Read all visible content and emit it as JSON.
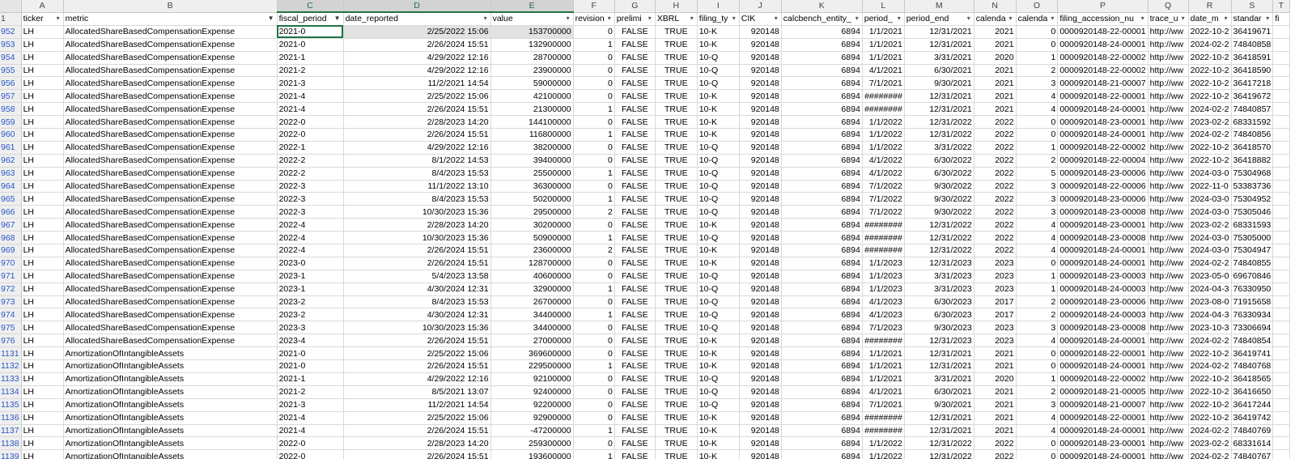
{
  "column_letters": [
    "A",
    "B",
    "C",
    "D",
    "E",
    "F",
    "G",
    "H",
    "I",
    "J",
    "K",
    "L",
    "M",
    "N",
    "O",
    "P",
    "Q",
    "R",
    "S",
    "T"
  ],
  "header_row_number": "1",
  "headers": [
    "ticker",
    "metric",
    "fiscal_period",
    "date_reported",
    "value",
    "revision",
    "prelimi",
    "XBRL",
    "filing_ty",
    "CIK",
    "calcbench_entity_",
    "period_",
    "period_end",
    "calenda",
    "calenda",
    "filing_accession_nu",
    "trace_u",
    "date_m",
    "standar",
    "fi"
  ],
  "filtered_columns": [
    "metric",
    "fiscal_period"
  ],
  "rows": [
    {
      "n": "952",
      "c": [
        "LH",
        "AllocatedShareBasedCompensationExpense",
        "2021-0",
        "2/25/2022 15:06",
        "153700000",
        "0",
        "FALSE",
        "TRUE",
        "10-K",
        "920148",
        "6894",
        "1/1/2021",
        "12/31/2021",
        "2021",
        "0",
        "0000920148-22-00001",
        "http://ww",
        "2022-10-2",
        "36419671",
        ""
      ]
    },
    {
      "n": "953",
      "c": [
        "LH",
        "AllocatedShareBasedCompensationExpense",
        "2021-0",
        "2/26/2024 15:51",
        "132900000",
        "1",
        "FALSE",
        "TRUE",
        "10-K",
        "920148",
        "6894",
        "1/1/2021",
        "12/31/2021",
        "2021",
        "0",
        "0000920148-24-00001",
        "http://ww",
        "2024-02-2",
        "74840858",
        ""
      ]
    },
    {
      "n": "954",
      "c": [
        "LH",
        "AllocatedShareBasedCompensationExpense",
        "2021-1",
        "4/29/2022 12:16",
        "28700000",
        "0",
        "FALSE",
        "TRUE",
        "10-Q",
        "920148",
        "6894",
        "1/1/2021",
        "3/31/2021",
        "2020",
        "1",
        "0000920148-22-00002",
        "http://ww",
        "2022-10-2",
        "36418591",
        ""
      ]
    },
    {
      "n": "955",
      "c": [
        "LH",
        "AllocatedShareBasedCompensationExpense",
        "2021-2",
        "4/29/2022 12:16",
        "23900000",
        "0",
        "FALSE",
        "TRUE",
        "10-Q",
        "920148",
        "6894",
        "4/1/2021",
        "6/30/2021",
        "2021",
        "2",
        "0000920148-22-00002",
        "http://ww",
        "2022-10-2",
        "36418590",
        ""
      ]
    },
    {
      "n": "956",
      "c": [
        "LH",
        "AllocatedShareBasedCompensationExpense",
        "2021-3",
        "11/2/2021 14:54",
        "59000000",
        "0",
        "FALSE",
        "TRUE",
        "10-Q",
        "920148",
        "6894",
        "7/1/2021",
        "9/30/2021",
        "2021",
        "3",
        "0000920148-21-00007",
        "http://ww",
        "2022-10-2",
        "36417218",
        ""
      ]
    },
    {
      "n": "957",
      "c": [
        "LH",
        "AllocatedShareBasedCompensationExpense",
        "2021-4",
        "2/25/2022 15:06",
        "42100000",
        "0",
        "FALSE",
        "TRUE",
        "10-K",
        "920148",
        "6894",
        "########",
        "12/31/2021",
        "2021",
        "4",
        "0000920148-22-00001",
        "http://ww",
        "2022-10-2",
        "36419672",
        ""
      ]
    },
    {
      "n": "958",
      "c": [
        "LH",
        "AllocatedShareBasedCompensationExpense",
        "2021-4",
        "2/26/2024 15:51",
        "21300000",
        "1",
        "FALSE",
        "TRUE",
        "10-K",
        "920148",
        "6894",
        "########",
        "12/31/2021",
        "2021",
        "4",
        "0000920148-24-00001",
        "http://ww",
        "2024-02-2",
        "74840857",
        ""
      ]
    },
    {
      "n": "959",
      "c": [
        "LH",
        "AllocatedShareBasedCompensationExpense",
        "2022-0",
        "2/28/2023 14:20",
        "144100000",
        "0",
        "FALSE",
        "TRUE",
        "10-K",
        "920148",
        "6894",
        "1/1/2022",
        "12/31/2022",
        "2022",
        "0",
        "0000920148-23-00001",
        "http://ww",
        "2023-02-2",
        "68331592",
        ""
      ]
    },
    {
      "n": "960",
      "c": [
        "LH",
        "AllocatedShareBasedCompensationExpense",
        "2022-0",
        "2/26/2024 15:51",
        "116800000",
        "1",
        "FALSE",
        "TRUE",
        "10-K",
        "920148",
        "6894",
        "1/1/2022",
        "12/31/2022",
        "2022",
        "0",
        "0000920148-24-00001",
        "http://ww",
        "2024-02-2",
        "74840856",
        ""
      ]
    },
    {
      "n": "961",
      "c": [
        "LH",
        "AllocatedShareBasedCompensationExpense",
        "2022-1",
        "4/29/2022 12:16",
        "38200000",
        "0",
        "FALSE",
        "TRUE",
        "10-Q",
        "920148",
        "6894",
        "1/1/2022",
        "3/31/2022",
        "2022",
        "1",
        "0000920148-22-00002",
        "http://ww",
        "2022-10-2",
        "36418570",
        ""
      ]
    },
    {
      "n": "962",
      "c": [
        "LH",
        "AllocatedShareBasedCompensationExpense",
        "2022-2",
        "8/1/2022 14:53",
        "39400000",
        "0",
        "FALSE",
        "TRUE",
        "10-Q",
        "920148",
        "6894",
        "4/1/2022",
        "6/30/2022",
        "2022",
        "2",
        "0000920148-22-00004",
        "http://ww",
        "2022-10-2",
        "36418882",
        ""
      ]
    },
    {
      "n": "963",
      "c": [
        "LH",
        "AllocatedShareBasedCompensationExpense",
        "2022-2",
        "8/4/2023 15:53",
        "25500000",
        "1",
        "FALSE",
        "TRUE",
        "10-Q",
        "920148",
        "6894",
        "4/1/2022",
        "6/30/2022",
        "2022",
        "5",
        "0000920148-23-00006",
        "http://ww",
        "2024-03-0",
        "75304968",
        ""
      ]
    },
    {
      "n": "964",
      "c": [
        "LH",
        "AllocatedShareBasedCompensationExpense",
        "2022-3",
        "11/1/2022 13:10",
        "36300000",
        "0",
        "FALSE",
        "TRUE",
        "10-Q",
        "920148",
        "6894",
        "7/1/2022",
        "9/30/2022",
        "2022",
        "3",
        "0000920148-22-00006",
        "http://ww",
        "2022-11-0",
        "53383736",
        ""
      ]
    },
    {
      "n": "965",
      "c": [
        "LH",
        "AllocatedShareBasedCompensationExpense",
        "2022-3",
        "8/4/2023 15:53",
        "50200000",
        "1",
        "FALSE",
        "TRUE",
        "10-Q",
        "920148",
        "6894",
        "7/1/2022",
        "9/30/2022",
        "2022",
        "3",
        "0000920148-23-00006",
        "http://ww",
        "2024-03-0",
        "75304952",
        ""
      ]
    },
    {
      "n": "966",
      "c": [
        "LH",
        "AllocatedShareBasedCompensationExpense",
        "2022-3",
        "10/30/2023 15:36",
        "29500000",
        "2",
        "FALSE",
        "TRUE",
        "10-Q",
        "920148",
        "6894",
        "7/1/2022",
        "9/30/2022",
        "2022",
        "3",
        "0000920148-23-00008",
        "http://ww",
        "2024-03-0",
        "75305046",
        ""
      ]
    },
    {
      "n": "967",
      "c": [
        "LH",
        "AllocatedShareBasedCompensationExpense",
        "2022-4",
        "2/28/2023 14:20",
        "30200000",
        "0",
        "FALSE",
        "TRUE",
        "10-K",
        "920148",
        "6894",
        "########",
        "12/31/2022",
        "2022",
        "4",
        "0000920148-23-00001",
        "http://ww",
        "2023-02-2",
        "68331593",
        ""
      ]
    },
    {
      "n": "968",
      "c": [
        "LH",
        "AllocatedShareBasedCompensationExpense",
        "2022-4",
        "10/30/2023 15:36",
        "50900000",
        "1",
        "FALSE",
        "TRUE",
        "10-Q",
        "920148",
        "6894",
        "########",
        "12/31/2022",
        "2022",
        "4",
        "0000920148-23-00008",
        "http://ww",
        "2024-03-0",
        "75305000",
        ""
      ]
    },
    {
      "n": "969",
      "c": [
        "LH",
        "AllocatedShareBasedCompensationExpense",
        "2022-4",
        "2/26/2024 15:51",
        "23600000",
        "2",
        "FALSE",
        "TRUE",
        "10-K",
        "920148",
        "6894",
        "########",
        "12/31/2022",
        "2022",
        "4",
        "0000920148-24-00001",
        "http://ww",
        "2024-03-0",
        "75304947",
        ""
      ]
    },
    {
      "n": "970",
      "c": [
        "LH",
        "AllocatedShareBasedCompensationExpense",
        "2023-0",
        "2/26/2024 15:51",
        "128700000",
        "0",
        "FALSE",
        "TRUE",
        "10-K",
        "920148",
        "6894",
        "1/1/2023",
        "12/31/2023",
        "2023",
        "0",
        "0000920148-24-00001",
        "http://ww",
        "2024-02-2",
        "74840855",
        ""
      ]
    },
    {
      "n": "971",
      "c": [
        "LH",
        "AllocatedShareBasedCompensationExpense",
        "2023-1",
        "5/4/2023 13:58",
        "40600000",
        "0",
        "FALSE",
        "TRUE",
        "10-Q",
        "920148",
        "6894",
        "1/1/2023",
        "3/31/2023",
        "2023",
        "1",
        "0000920148-23-00003",
        "http://ww",
        "2023-05-0",
        "69670846",
        ""
      ]
    },
    {
      "n": "972",
      "c": [
        "LH",
        "AllocatedShareBasedCompensationExpense",
        "2023-1",
        "4/30/2024 12:31",
        "32900000",
        "1",
        "FALSE",
        "TRUE",
        "10-Q",
        "920148",
        "6894",
        "1/1/2023",
        "3/31/2023",
        "2023",
        "1",
        "0000920148-24-00003",
        "http://ww",
        "2024-04-3",
        "76330950",
        ""
      ]
    },
    {
      "n": "973",
      "c": [
        "LH",
        "AllocatedShareBasedCompensationExpense",
        "2023-2",
        "8/4/2023 15:53",
        "26700000",
        "0",
        "FALSE",
        "TRUE",
        "10-Q",
        "920148",
        "6894",
        "4/1/2023",
        "6/30/2023",
        "2017",
        "2",
        "0000920148-23-00006",
        "http://ww",
        "2023-08-0",
        "71915658",
        ""
      ]
    },
    {
      "n": "974",
      "c": [
        "LH",
        "AllocatedShareBasedCompensationExpense",
        "2023-2",
        "4/30/2024 12:31",
        "34400000",
        "1",
        "FALSE",
        "TRUE",
        "10-Q",
        "920148",
        "6894",
        "4/1/2023",
        "6/30/2023",
        "2017",
        "2",
        "0000920148-24-00003",
        "http://ww",
        "2024-04-3",
        "76330934",
        ""
      ]
    },
    {
      "n": "975",
      "c": [
        "LH",
        "AllocatedShareBasedCompensationExpense",
        "2023-3",
        "10/30/2023 15:36",
        "34400000",
        "0",
        "FALSE",
        "TRUE",
        "10-Q",
        "920148",
        "6894",
        "7/1/2023",
        "9/30/2023",
        "2023",
        "3",
        "0000920148-23-00008",
        "http://ww",
        "2023-10-3",
        "73306694",
        ""
      ]
    },
    {
      "n": "976",
      "c": [
        "LH",
        "AllocatedShareBasedCompensationExpense",
        "2023-4",
        "2/26/2024 15:51",
        "27000000",
        "0",
        "FALSE",
        "TRUE",
        "10-K",
        "920148",
        "6894",
        "########",
        "12/31/2023",
        "2023",
        "4",
        "0000920148-24-00001",
        "http://ww",
        "2024-02-2",
        "74840854",
        ""
      ]
    },
    {
      "n": "1131",
      "c": [
        "LH",
        "AmortizationOfIntangibleAssets",
        "2021-0",
        "2/25/2022 15:06",
        "369600000",
        "0",
        "FALSE",
        "TRUE",
        "10-K",
        "920148",
        "6894",
        "1/1/2021",
        "12/31/2021",
        "2021",
        "0",
        "0000920148-22-00001",
        "http://ww",
        "2022-10-2",
        "36419741",
        ""
      ]
    },
    {
      "n": "1132",
      "c": [
        "LH",
        "AmortizationOfIntangibleAssets",
        "2021-0",
        "2/26/2024 15:51",
        "229500000",
        "1",
        "FALSE",
        "TRUE",
        "10-K",
        "920148",
        "6894",
        "1/1/2021",
        "12/31/2021",
        "2021",
        "0",
        "0000920148-24-00001",
        "http://ww",
        "2024-02-2",
        "74840768",
        ""
      ]
    },
    {
      "n": "1133",
      "c": [
        "LH",
        "AmortizationOfIntangibleAssets",
        "2021-1",
        "4/29/2022 12:16",
        "92100000",
        "0",
        "FALSE",
        "TRUE",
        "10-Q",
        "920148",
        "6894",
        "1/1/2021",
        "3/31/2021",
        "2020",
        "1",
        "0000920148-22-00002",
        "http://ww",
        "2022-10-2",
        "36418565",
        ""
      ]
    },
    {
      "n": "1134",
      "c": [
        "LH",
        "AmortizationOfIntangibleAssets",
        "2021-2",
        "8/5/2021 13:07",
        "92400000",
        "0",
        "FALSE",
        "TRUE",
        "10-Q",
        "920148",
        "6894",
        "4/1/2021",
        "6/30/2021",
        "2021",
        "2",
        "0000920148-21-00005",
        "http://ww",
        "2022-10-2",
        "36416650",
        ""
      ]
    },
    {
      "n": "1135",
      "c": [
        "LH",
        "AmortizationOfIntangibleAssets",
        "2021-3",
        "11/2/2021 14:54",
        "92200000",
        "0",
        "FALSE",
        "TRUE",
        "10-Q",
        "920148",
        "6894",
        "7/1/2021",
        "9/30/2021",
        "2021",
        "3",
        "0000920148-21-00007",
        "http://ww",
        "2022-10-2",
        "36417244",
        ""
      ]
    },
    {
      "n": "1136",
      "c": [
        "LH",
        "AmortizationOfIntangibleAssets",
        "2021-4",
        "2/25/2022 15:06",
        "92900000",
        "0",
        "FALSE",
        "TRUE",
        "10-K",
        "920148",
        "6894",
        "########",
        "12/31/2021",
        "2021",
        "4",
        "0000920148-22-00001",
        "http://ww",
        "2022-10-2",
        "36419742",
        ""
      ]
    },
    {
      "n": "1137",
      "c": [
        "LH",
        "AmortizationOfIntangibleAssets",
        "2021-4",
        "2/26/2024 15:51",
        "-47200000",
        "1",
        "FALSE",
        "TRUE",
        "10-K",
        "920148",
        "6894",
        "########",
        "12/31/2021",
        "2021",
        "4",
        "0000920148-24-00001",
        "http://ww",
        "2024-02-2",
        "74840769",
        ""
      ]
    },
    {
      "n": "1138",
      "c": [
        "LH",
        "AmortizationOfIntangibleAssets",
        "2022-0",
        "2/28/2023 14:20",
        "259300000",
        "0",
        "FALSE",
        "TRUE",
        "10-K",
        "920148",
        "6894",
        "1/1/2022",
        "12/31/2022",
        "2022",
        "0",
        "0000920148-23-00001",
        "http://ww",
        "2023-02-2",
        "68331614",
        ""
      ]
    },
    {
      "n": "1139",
      "c": [
        "LH",
        "AmortizationOfIntangibleAssets",
        "2022-0",
        "2/26/2024 15:51",
        "193600000",
        "1",
        "FALSE",
        "TRUE",
        "10-K",
        "920148",
        "6894",
        "1/1/2022",
        "12/31/2022",
        "2022",
        "0",
        "0000920148-24-00001",
        "http://ww",
        "2024-02-2",
        "74840767",
        ""
      ]
    }
  ]
}
